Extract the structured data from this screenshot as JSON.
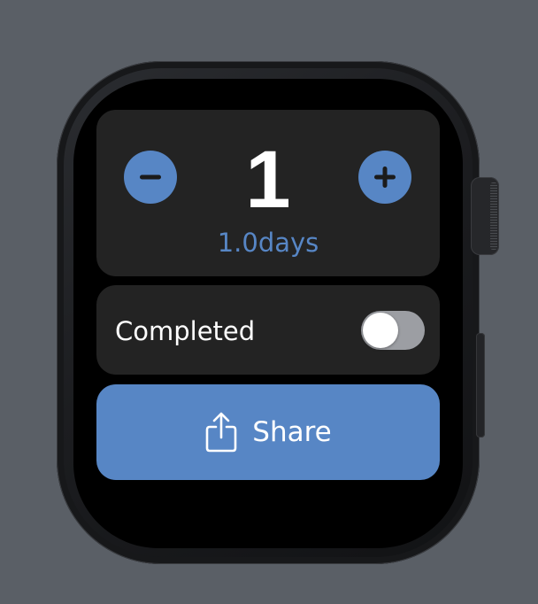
{
  "counter": {
    "value": "1",
    "unit_text": "1.0days",
    "decrement_icon": "minus-icon",
    "increment_icon": "plus-icon"
  },
  "completed_row": {
    "label": "Completed",
    "toggle_on": false
  },
  "share_button": {
    "label": "Share",
    "icon": "share-icon"
  },
  "colors": {
    "accent": "#5786c5",
    "card_background": "#232323",
    "screen_background": "#000000",
    "toggle_off_track": "#9c9ea3",
    "page_background": "#5a5f66"
  }
}
